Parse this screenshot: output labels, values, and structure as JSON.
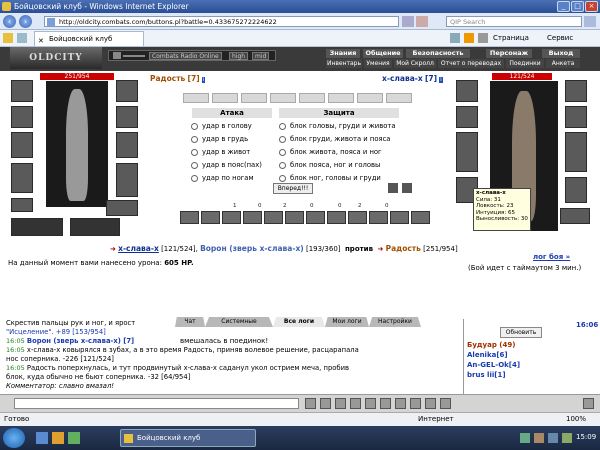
{
  "window": {
    "title": "Бойцовский клуб - Windows Internet Explorer",
    "url": "http://oldcity.combats.com/buttons.pl?battle=0.433675272224622",
    "search_placeholder": "QIP Search",
    "tab_title": "Бойцовский клуб",
    "cmd_page": "Страница",
    "cmd_service": "Сервис",
    "status": "Готово",
    "zone": "Интернет",
    "zoom": "100%",
    "taskbar_item": "Бойцовский клуб",
    "clock": "15:09"
  },
  "game": {
    "logo": "OLDCITY",
    "radio_label": "Combats Radio Online",
    "radio_high": "high",
    "radio_mid": "mid",
    "menu_row1": [
      "Знания",
      "Общение",
      "Безопасность",
      "Персонаж",
      "Выход"
    ],
    "menu_row2": [
      "Инвентарь",
      "Умения",
      "Мой Скролл",
      "Отчет о переводах",
      "Поединки",
      "Анкета"
    ],
    "player": {
      "name": "Радость",
      "level": "[7]",
      "hp": "251/954"
    },
    "opponent": {
      "name": "x-слава-x",
      "level": "[7]",
      "hp": "121/524"
    },
    "attack_header": "Атака",
    "defense_header": "Защита",
    "attacks": [
      "удар в голову",
      "удар в грудь",
      "удар в живот",
      "удар в пояс(пах)",
      "удар по ногам"
    ],
    "defenses": [
      "блок головы, груди и живота",
      "блок груди, живота и пояса",
      "блок живота, пояса и ног",
      "блок пояса, ног и головы",
      "блок ног, головы и груди"
    ],
    "forward_button": "Вперед!!!",
    "skill_counts": [
      "1",
      "0",
      "2",
      "0",
      "0",
      "2",
      "0"
    ],
    "tooltip": {
      "name": "x-слава-x",
      "lines": [
        "Сила: 31",
        "Ловкость: 23",
        "Интуиция: 65",
        "Выносливость: 30"
      ]
    },
    "vs": {
      "left_name": "x-слава-x",
      "left_hp": "[121/524]",
      "mid_name": "Ворон (зверь x-слава-x)",
      "mid_hp": "[193/360]",
      "versus": "против",
      "right_name": "Радость",
      "right_hp": "[251/954]"
    },
    "damage_text": "На данный момент вами нанесено урона:",
    "damage_value": "605 HP.",
    "log_link": "лог боя »",
    "timeout_text": "(Бой идет с таймаутом 3 мин.)"
  },
  "chat": {
    "tabs": [
      "Чат",
      "Системные сообщения",
      "Все логи",
      "Мои логи",
      "Настройки"
    ],
    "lines": [
      {
        "time": "",
        "text": "Скрестив пальцы рук и ног, и ярост"
      },
      {
        "time": "",
        "text": "\"Исцеление\". +89 [153/954]"
      },
      {
        "time": "16:05",
        "text": "Ворон (зверь x-слава-x) [7]"
      },
      {
        "time": "16:05",
        "text": "x-слава-x ковырялся в зубах, а в это время Радость, приняв волевое решение, расцарапала"
      },
      {
        "time": "",
        "text": "нос соперника. -226 [121/524]"
      },
      {
        "time": "16:05",
        "text": "Радость поперхнулась, и тут продвинутый x-слава-x саданул укол острием меча, пробив"
      },
      {
        "time": "",
        "text": "блок, куда обычно не бьют соперника. -32 [64/954]"
      },
      {
        "time": "",
        "text": "Комментатор: славно вмазал!"
      }
    ],
    "right_fragment": "вмешалась в поединок!"
  },
  "buddy": {
    "refresh_button": "Обновить",
    "title": "Будуар (49)",
    "members": [
      "Alenika[6]",
      "An-GEL-Ok[4]",
      "brus lii[1]"
    ],
    "clock": "16:06"
  }
}
